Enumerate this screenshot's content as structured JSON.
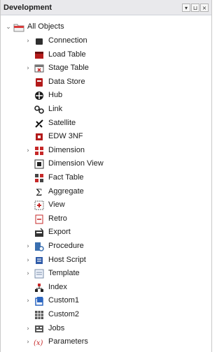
{
  "panel": {
    "title": "Development",
    "buttons": [
      "▾",
      "⊔",
      "×"
    ]
  },
  "tree": {
    "root": {
      "label": "All Objects",
      "expanded": true,
      "icon": "folder-icon"
    },
    "items": [
      {
        "label": "Connection",
        "expandable": true,
        "icon": "connection-icon"
      },
      {
        "label": "Load Table",
        "expandable": false,
        "icon": "load-table-icon"
      },
      {
        "label": "Stage Table",
        "expandable": true,
        "icon": "stage-table-icon"
      },
      {
        "label": "Data Store",
        "expandable": false,
        "icon": "data-store-icon"
      },
      {
        "label": "Hub",
        "expandable": false,
        "icon": "hub-icon"
      },
      {
        "label": "Link",
        "expandable": false,
        "icon": "link-icon"
      },
      {
        "label": "Satellite",
        "expandable": false,
        "icon": "satellite-icon"
      },
      {
        "label": "EDW 3NF",
        "expandable": false,
        "icon": "edw-icon"
      },
      {
        "label": "Dimension",
        "expandable": true,
        "icon": "dimension-icon"
      },
      {
        "label": "Dimension View",
        "expandable": false,
        "icon": "dimension-view-icon"
      },
      {
        "label": "Fact Table",
        "expandable": false,
        "icon": "fact-table-icon"
      },
      {
        "label": "Aggregate",
        "expandable": false,
        "icon": "aggregate-icon"
      },
      {
        "label": "View",
        "expandable": false,
        "icon": "view-icon"
      },
      {
        "label": "Retro",
        "expandable": false,
        "icon": "retro-icon"
      },
      {
        "label": "Export",
        "expandable": false,
        "icon": "export-icon"
      },
      {
        "label": "Procedure",
        "expandable": true,
        "icon": "procedure-icon"
      },
      {
        "label": "Host Script",
        "expandable": true,
        "icon": "host-script-icon"
      },
      {
        "label": "Template",
        "expandable": true,
        "icon": "template-icon"
      },
      {
        "label": "Index",
        "expandable": false,
        "icon": "index-icon"
      },
      {
        "label": "Custom1",
        "expandable": true,
        "icon": "custom1-icon"
      },
      {
        "label": "Custom2",
        "expandable": false,
        "icon": "custom2-icon"
      },
      {
        "label": "Jobs",
        "expandable": true,
        "icon": "jobs-icon"
      },
      {
        "label": "Parameters",
        "expandable": true,
        "icon": "parameters-icon"
      }
    ]
  }
}
